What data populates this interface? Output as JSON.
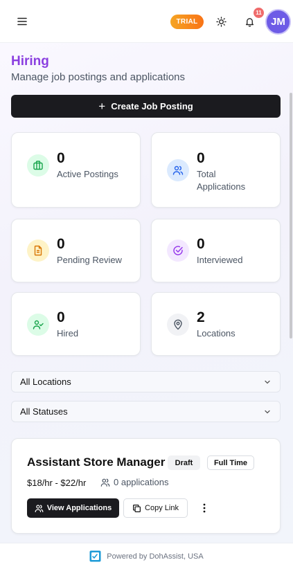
{
  "header": {
    "menu_icon": "menu-icon",
    "trial_label": "TRIAL",
    "theme_icon": "sun-icon",
    "bell_icon": "bell-icon",
    "notification_count": "11",
    "avatar_initials": "JM",
    "colors": {
      "trial_start": "#f5a524",
      "trial_end": "#f97316",
      "avatar": "#6d5be6",
      "badge": "#ef6b6b"
    }
  },
  "page": {
    "title": "Hiring",
    "subtitle": "Manage job postings and applications",
    "title_color": "#8b3fe0"
  },
  "create_button": {
    "label": "Create Job Posting",
    "icon": "plus-icon"
  },
  "stats": [
    {
      "value": "0",
      "label": "Active Postings",
      "icon": "briefcase-icon",
      "bg": "#dcfce7",
      "color": "#16a34a"
    },
    {
      "value": "0",
      "label": "Total Applications",
      "icon": "users-icon",
      "bg": "#dbeafe",
      "color": "#2563eb"
    },
    {
      "value": "0",
      "label": "Pending Review",
      "icon": "document-icon",
      "bg": "#fef3c7",
      "color": "#d97706"
    },
    {
      "value": "0",
      "label": "Interviewed",
      "icon": "check-circle-icon",
      "bg": "#f3e8ff",
      "color": "#9333ea"
    },
    {
      "value": "0",
      "label": "Hired",
      "icon": "user-check-icon",
      "bg": "#dcfce7",
      "color": "#16a34a"
    },
    {
      "value": "2",
      "label": "Locations",
      "icon": "map-pin-icon",
      "bg": "#f1f2f5",
      "color": "#4b5563"
    }
  ],
  "filters": {
    "location": {
      "selected": "All Locations"
    },
    "status": {
      "selected": "All Statuses"
    }
  },
  "job": {
    "title": "Assistant Store Manager",
    "status": "Draft",
    "type": "Full Time",
    "salary": "$18/hr - $22/hr",
    "applications": "0 applications",
    "view_label": "View Applications",
    "copy_label": "Copy Link"
  },
  "footer": {
    "text": "Powered by DohAssist, USA",
    "logo_icon": "dohassist-logo-icon"
  }
}
